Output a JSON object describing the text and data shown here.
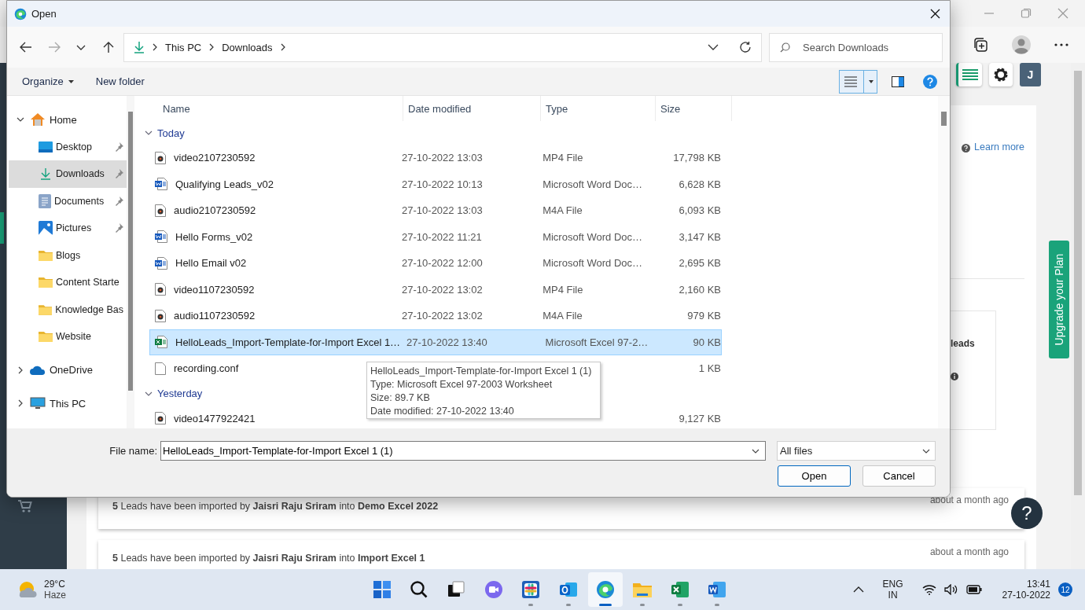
{
  "browser": {
    "header_avatar": "J",
    "learn_more": "Learn more",
    "upgrade_tab": "Upgrade your Plan",
    "card_label": "leads",
    "activities": [
      {
        "text": "**5** Leads have been imported by **Jaisri Raju Sriram** into **Demo Excel 2022**",
        "time": "about a month ago"
      },
      {
        "text": "**5** Leads have been imported by **Jaisri Raju Sriram** into **Import Excel 1**",
        "time": "about a month ago"
      }
    ],
    "help_button": "?"
  },
  "dialog": {
    "title": "Open",
    "breadcrumb": [
      "This PC",
      "Downloads"
    ],
    "search": {
      "placeholder": "Search Downloads"
    },
    "commands": [
      "Organize",
      "New folder"
    ],
    "nav": [
      {
        "label": "Home",
        "kind": "home",
        "expanded": true,
        "selected": false,
        "children": [
          {
            "label": "Desktop",
            "kind": "desktop",
            "pinned": true,
            "selected": false
          },
          {
            "label": "Downloads",
            "kind": "downloads",
            "pinned": true,
            "selected": true
          },
          {
            "label": "Documents",
            "kind": "documents",
            "pinned": true,
            "selected": false
          },
          {
            "label": "Pictures",
            "kind": "pictures",
            "pinned": true,
            "selected": false
          },
          {
            "label": "Blogs",
            "kind": "folder",
            "pinned": false,
            "selected": false
          },
          {
            "label": "Content Starte",
            "kind": "folder",
            "pinned": false,
            "selected": false
          },
          {
            "label": "Knowledge Bas",
            "kind": "folder",
            "pinned": false,
            "selected": false
          },
          {
            "label": "Website",
            "kind": "folder",
            "pinned": false,
            "selected": false
          }
        ]
      },
      {
        "label": "OneDrive",
        "kind": "cloud",
        "expanded": false,
        "selected": false
      },
      {
        "label": "This PC",
        "kind": "pc",
        "expanded": false,
        "selected": false
      }
    ],
    "columns": [
      "Name",
      "Date modified",
      "Type",
      "Size"
    ],
    "groups": [
      {
        "label": "Today",
        "expanded": true,
        "files": [
          {
            "name": "video2107230592",
            "kind": "media",
            "date": "27-10-2022 13:03",
            "type": "MP4 File",
            "size": "17,798 KB",
            "selected": false
          },
          {
            "name": "Qualifying Leads_v02",
            "kind": "word",
            "date": "27-10-2022 10:13",
            "type": "Microsoft Word Doc…",
            "size": "6,628 KB",
            "selected": false
          },
          {
            "name": "audio2107230592",
            "kind": "media",
            "date": "27-10-2022 13:03",
            "type": "M4A File",
            "size": "6,093 KB",
            "selected": false
          },
          {
            "name": "Hello Forms_v02",
            "kind": "word",
            "date": "27-10-2022 11:21",
            "type": "Microsoft Word Doc…",
            "size": "3,147 KB",
            "selected": false
          },
          {
            "name": "Hello Email v02",
            "kind": "word",
            "date": "27-10-2022 12:00",
            "type": "Microsoft Word Doc…",
            "size": "2,695 KB",
            "selected": false
          },
          {
            "name": "video1107230592",
            "kind": "media",
            "date": "27-10-2022 13:02",
            "type": "MP4 File",
            "size": "2,160 KB",
            "selected": false
          },
          {
            "name": "audio1107230592",
            "kind": "media",
            "date": "27-10-2022 13:02",
            "type": "M4A File",
            "size": "979 KB",
            "selected": false
          },
          {
            "name": "HelloLeads_Import-Template-for-Import Excel 1…",
            "kind": "excel",
            "date": "27-10-2022 13:40",
            "type": "Microsoft Excel 97-2…",
            "size": "90 KB",
            "selected": true
          },
          {
            "name": "recording.conf",
            "kind": "file",
            "size": "1 KB",
            "selected": false
          }
        ]
      },
      {
        "label": "Yesterday",
        "expanded": true,
        "files": [
          {
            "name": "video1477922421",
            "kind": "media",
            "size": "9,127 KB",
            "selected": false
          }
        ]
      }
    ],
    "tooltip": [
      "HelloLeads_Import-Template-for-Import Excel 1 (1)",
      "Type: Microsoft Excel 97-2003 Worksheet",
      "Size: 89.7 KB",
      "Date modified: 27-10-2022 13:40"
    ],
    "file_name": {
      "label": "File name:",
      "value": "HelloLeads_Import-Template-for-Import Excel 1 (1)"
    },
    "filter": "All files",
    "buttons": [
      "Open",
      "Cancel"
    ]
  },
  "taskbar": {
    "weather": {
      "temp": "29°C",
      "condition": "Haze"
    },
    "apps": [
      {
        "kind": "start",
        "running": false,
        "selected": false
      },
      {
        "kind": "search",
        "running": false,
        "selected": false
      },
      {
        "kind": "taskview",
        "running": false,
        "selected": false
      },
      {
        "kind": "chat",
        "running": false,
        "selected": false
      },
      {
        "kind": "slack",
        "running": true,
        "selected": false
      },
      {
        "kind": "outlook",
        "running": true,
        "selected": false
      },
      {
        "kind": "edge",
        "running": true,
        "selected": true
      },
      {
        "kind": "explorer",
        "running": true,
        "selected": false
      },
      {
        "kind": "excel",
        "running": true,
        "selected": false
      },
      {
        "kind": "word",
        "running": true,
        "selected": false
      }
    ],
    "language": [
      "ENG",
      "IN"
    ],
    "time": "13:41",
    "date": "27-10-2022",
    "notifications": "12"
  }
}
